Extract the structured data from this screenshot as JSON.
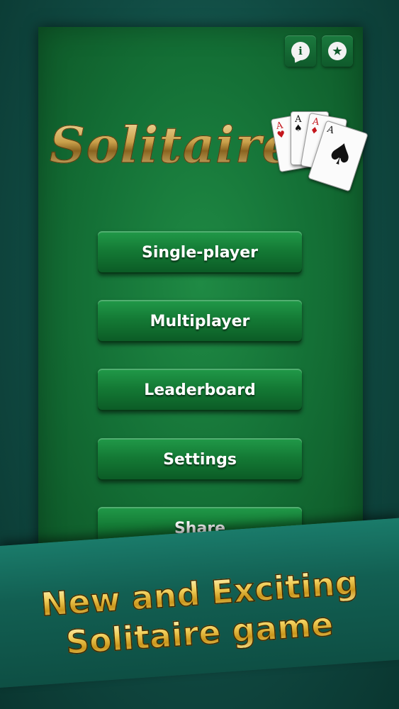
{
  "header": {
    "info_icon": "info-icon",
    "star_icon": "star-icon",
    "info_glyph": "i",
    "star_glyph": "★"
  },
  "logo": {
    "title": "Solitaire",
    "cards": [
      {
        "rank": "A",
        "suit": "♥"
      },
      {
        "rank": "A",
        "suit": "♠"
      },
      {
        "rank": "A",
        "suit": "♦"
      },
      {
        "rank": "A",
        "suit": "♠"
      }
    ]
  },
  "menu": {
    "single_player": "Single-player",
    "multiplayer": "Multiplayer",
    "leaderboard": "Leaderboard",
    "settings": "Settings",
    "share": "Share"
  },
  "promo": {
    "line1": "New and Exciting",
    "line2": "Solitaire game"
  },
  "colors": {
    "felt": "#147036",
    "background": "#104a42",
    "button": "#147a35",
    "gold": "#f0cd58"
  }
}
